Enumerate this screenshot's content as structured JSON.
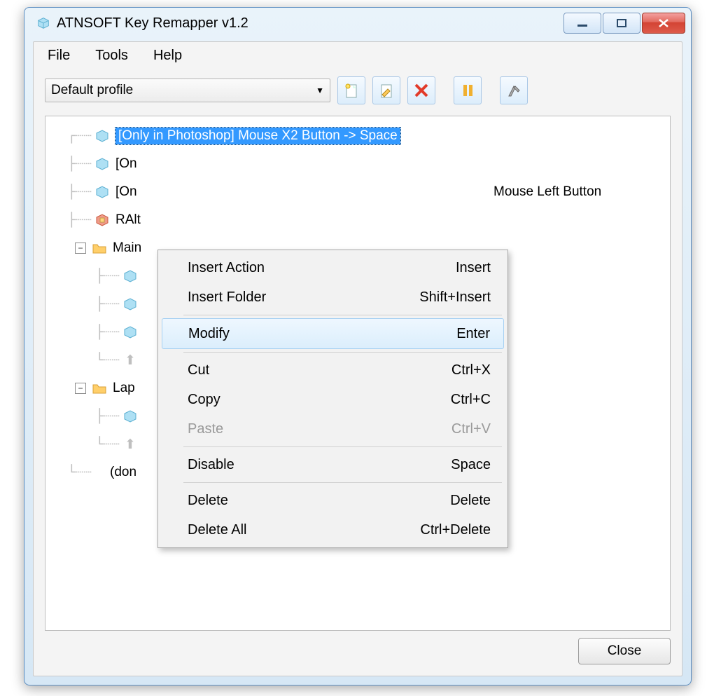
{
  "titlebar": {
    "title": "ATNSOFT Key Remapper v1.2"
  },
  "menubar": {
    "file": "File",
    "tools": "Tools",
    "help": "Help"
  },
  "toolbar": {
    "profile": "Default profile"
  },
  "tree": {
    "row0": "[Only in Photoshop] Mouse X2 Button -> Space",
    "row1": "[On",
    "row2_a": "[On",
    "row2_b": "Mouse Left Button",
    "row3": "RAlt",
    "row4": "Main",
    "row9": "Lap",
    "row_last": "(don"
  },
  "context": {
    "insert_action": "Insert Action",
    "insert_action_sc": "Insert",
    "insert_folder": "Insert Folder",
    "insert_folder_sc": "Shift+Insert",
    "modify": "Modify",
    "modify_sc": "Enter",
    "cut": "Cut",
    "cut_sc": "Ctrl+X",
    "copy": "Copy",
    "copy_sc": "Ctrl+C",
    "paste": "Paste",
    "paste_sc": "Ctrl+V",
    "disable": "Disable",
    "disable_sc": "Space",
    "delete": "Delete",
    "delete_sc": "Delete",
    "delete_all": "Delete All",
    "delete_all_sc": "Ctrl+Delete"
  },
  "footer": {
    "close": "Close"
  }
}
